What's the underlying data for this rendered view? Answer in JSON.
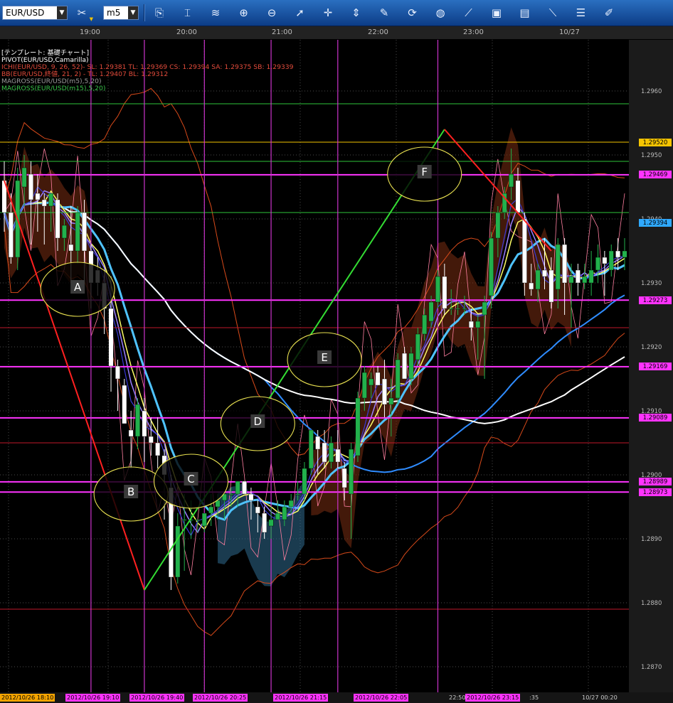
{
  "toolbar": {
    "symbol": "EUR/USD",
    "timeframe": "m5",
    "tools": [
      {
        "name": "clone-chart-icon",
        "glyph": "⎘"
      },
      {
        "name": "candle-style-icon",
        "glyph": "⌶"
      },
      {
        "name": "line-chart-icon",
        "glyph": "≋"
      },
      {
        "name": "zoom-in-icon",
        "glyph": "⊕"
      },
      {
        "name": "zoom-out-icon",
        "glyph": "⊖"
      },
      {
        "name": "cursor-icon",
        "glyph": "➚"
      },
      {
        "name": "crosshair-icon",
        "glyph": "✛"
      },
      {
        "name": "period-separator-icon",
        "glyph": "⇕"
      },
      {
        "name": "edit-chart-icon",
        "glyph": "✎"
      },
      {
        "name": "refresh-icon",
        "glyph": "⟳"
      },
      {
        "name": "globe-icon",
        "glyph": "◍"
      },
      {
        "name": "ruler-icon",
        "glyph": "⟋"
      },
      {
        "name": "image-icon",
        "glyph": "▣"
      },
      {
        "name": "screenshot-icon",
        "glyph": "▤"
      },
      {
        "name": "draw-line-icon",
        "glyph": "⟍"
      },
      {
        "name": "layers-icon",
        "glyph": "☰"
      },
      {
        "name": "pen-icon",
        "glyph": "✐"
      }
    ]
  },
  "time_axis": [
    "19:00",
    "20:00",
    "21:00",
    "22:00",
    "23:00",
    "10/27"
  ],
  "legend": [
    {
      "text": "[テンプレート: 基礎チャート]",
      "color": "#ffffff"
    },
    {
      "text": "PIVOT(EUR/USD,Camarilla)",
      "color": "#ffffff"
    },
    {
      "text": "ICHI(EUR/USD, 9, 26, 52)- SL: 1.29381 TL: 1.29369 CS: 1.29394 SA: 1.29375 SB: 1.29339",
      "color": "#e24b3b"
    },
    {
      "text": "BB(EUR/USD,終値, 21, 2) - TL: 1.29407 BL: 1.29312",
      "color": "#e24b3b"
    },
    {
      "text": "MAGROSS(EUR/USD(m5),5,20)",
      "color": "#9a9a9a"
    },
    {
      "text": "MAGROSS(EUR/USD(m15),5,20)",
      "color": "#39c44a"
    }
  ],
  "price_badges": [
    {
      "text": "1.29520",
      "bg": "#f5c400",
      "fg": "#000000",
      "price": 1.2952
    },
    {
      "text": "1.29469",
      "bg": "#ff33ff",
      "fg": "#000000",
      "price": 1.29469
    },
    {
      "text": "1.29394",
      "bg": "#2fa9ff",
      "fg": "#000000",
      "price": 1.29394
    },
    {
      "text": "1.29273",
      "bg": "#ff33ff",
      "fg": "#000000",
      "price": 1.29273
    },
    {
      "text": "1.29169",
      "bg": "#ff33ff",
      "fg": "#000000",
      "price": 1.29169
    },
    {
      "text": "1.29089",
      "bg": "#ff33ff",
      "fg": "#000000",
      "price": 1.29089
    },
    {
      "text": "1.28989",
      "bg": "#ff33ff",
      "fg": "#000000",
      "price": 1.28989
    },
    {
      "text": "1.28973",
      "bg": "#ff33ff",
      "fg": "#000000",
      "price": 1.28973
    }
  ],
  "date_axis": [
    {
      "text": "2012/10/26 18:10",
      "bg": "#f5a400",
      "fg": "#000000"
    },
    {
      "text": "2012/10/26 19:10",
      "bg": "#ff33ff",
      "fg": "#000000"
    },
    {
      "text": "2012/10/26 19:40",
      "bg": "#ff33ff",
      "fg": "#000000"
    },
    {
      "text": "2012/10/26 20:25",
      "bg": "#ff33ff",
      "fg": "#000000"
    },
    {
      "text": "2012/10/26 21:15",
      "bg": "#ff33ff",
      "fg": "#000000"
    },
    {
      "text": "2012/10/26 22:05",
      "bg": "#ff33ff",
      "fg": "#000000"
    },
    {
      "text": "22:50",
      "bg": "#151515",
      "fg": "#cccccc"
    },
    {
      "text": "2012/10/26 23:15",
      "bg": "#ff33ff",
      "fg": "#000000"
    },
    {
      "text": ":35",
      "bg": "#151515",
      "fg": "#cccccc"
    },
    {
      "text": "10/27 00:20",
      "bg": "#151515",
      "fg": "#cccccc"
    }
  ],
  "chart_data": {
    "type": "candlestick",
    "symbol": "EUR/USD",
    "timeframe": "m5",
    "ylim": [
      1.2866,
      1.2968
    ],
    "y_ticks": [
      1.296,
      1.295,
      1.294,
      1.293,
      1.292,
      1.291,
      1.29,
      1.289,
      1.288,
      1.287
    ],
    "y_tick_labels": [
      "1.2960",
      "1.2950",
      "1.2940",
      "1.2930",
      "1.2920",
      "1.2910",
      "1.2900",
      "1.2890",
      "1.2880",
      "1.2870"
    ],
    "colors": {
      "up": "#22b14c",
      "down": "#ffffff",
      "background": "#000000",
      "grid": "#4a4a4a",
      "pivot": "#ff33ff",
      "marker": "#cc33cc"
    },
    "candles": [
      [
        1.2946,
        1.2949,
        1.2938,
        1.2941
      ],
      [
        1.2941,
        1.2944,
        1.2933,
        1.2934
      ],
      [
        1.2934,
        1.2948,
        1.2932,
        1.2946
      ],
      [
        1.2945,
        1.295,
        1.2942,
        1.2948
      ],
      [
        1.2947,
        1.2949,
        1.2936,
        1.2943
      ],
      [
        1.2944,
        1.2947,
        1.2938,
        1.2943
      ],
      [
        1.2943,
        1.2944,
        1.2936,
        1.2942
      ],
      [
        1.2942,
        1.2944,
        1.2938,
        1.2944
      ],
      [
        1.2943,
        1.2944,
        1.2935,
        1.2937
      ],
      [
        1.2937,
        1.294,
        1.2935,
        1.2939
      ],
      [
        1.2936,
        1.2942,
        1.293,
        1.2935
      ],
      [
        1.2935,
        1.2942,
        1.2933,
        1.2941
      ],
      [
        1.2941,
        1.2943,
        1.293,
        1.2935
      ],
      [
        1.2935,
        1.2936,
        1.2926,
        1.293
      ],
      [
        1.2932,
        1.2934,
        1.2928,
        1.293
      ],
      [
        1.293,
        1.2932,
        1.2922,
        1.2926
      ],
      [
        1.2926,
        1.2931,
        1.2913,
        1.2917
      ],
      [
        1.2917,
        1.2918,
        1.291,
        1.2915
      ],
      [
        1.2914,
        1.2915,
        1.2908,
        1.2908
      ],
      [
        1.2907,
        1.291,
        1.2901,
        1.2906
      ],
      [
        1.2906,
        1.2912,
        1.2904,
        1.2911
      ],
      [
        1.291,
        1.2912,
        1.2902,
        1.2906
      ],
      [
        1.2906,
        1.2909,
        1.2903,
        1.2905
      ],
      [
        1.2905,
        1.2909,
        1.2901,
        1.2903
      ],
      [
        1.2903,
        1.2904,
        1.2893,
        1.29
      ],
      [
        1.2898,
        1.29,
        1.2882,
        1.2884
      ],
      [
        1.2884,
        1.2894,
        1.2883,
        1.2892
      ],
      [
        1.2893,
        1.2897,
        1.2885,
        1.2893
      ],
      [
        1.2893,
        1.2896,
        1.289,
        1.2893
      ],
      [
        1.2893,
        1.2893,
        1.2891,
        1.2893
      ],
      [
        1.2892,
        1.2894,
        1.2891,
        1.2894
      ],
      [
        1.2894,
        1.2897,
        1.2892,
        1.2895
      ],
      [
        1.2895,
        1.2897,
        1.2893,
        1.2896
      ],
      [
        1.2896,
        1.2897,
        1.2893,
        1.2897
      ],
      [
        1.2897,
        1.2898,
        1.2895,
        1.2897
      ],
      [
        1.2897,
        1.2899,
        1.2895,
        1.2899
      ],
      [
        1.2899,
        1.2899,
        1.2897,
        1.2897
      ],
      [
        1.2897,
        1.2898,
        1.2893,
        1.2896
      ],
      [
        1.2895,
        1.2896,
        1.2891,
        1.2894
      ],
      [
        1.2894,
        1.2895,
        1.289,
        1.2891
      ],
      [
        1.2892,
        1.2895,
        1.289,
        1.2893
      ],
      [
        1.2893,
        1.2896,
        1.2893,
        1.2894
      ],
      [
        1.2893,
        1.2896,
        1.2892,
        1.2895
      ],
      [
        1.2895,
        1.2897,
        1.2894,
        1.2896
      ],
      [
        1.2897,
        1.2899,
        1.2896,
        1.2897
      ],
      [
        1.2897,
        1.2902,
        1.2896,
        1.2901
      ],
      [
        1.2901,
        1.2907,
        1.29,
        1.2907
      ],
      [
        1.2906,
        1.2907,
        1.29,
        1.2904
      ],
      [
        1.2905,
        1.2907,
        1.2901,
        1.2902
      ],
      [
        1.2902,
        1.2906,
        1.2901,
        1.2905
      ],
      [
        1.2904,
        1.2907,
        1.2901,
        1.2902
      ],
      [
        1.2901,
        1.2902,
        1.2896,
        1.2898
      ],
      [
        1.2897,
        1.2905,
        1.289,
        1.2904
      ],
      [
        1.2903,
        1.2913,
        1.2902,
        1.2912
      ],
      [
        1.2912,
        1.2917,
        1.291,
        1.2916
      ],
      [
        1.2914,
        1.2916,
        1.2912,
        1.2915
      ],
      [
        1.2916,
        1.2917,
        1.2914,
        1.2914
      ],
      [
        1.2915,
        1.2918,
        1.2909,
        1.2911
      ],
      [
        1.2911,
        1.2915,
        1.2906,
        1.2912
      ],
      [
        1.2912,
        1.2919,
        1.2911,
        1.2918
      ],
      [
        1.2919,
        1.292,
        1.2915,
        1.2915
      ],
      [
        1.2915,
        1.292,
        1.2914,
        1.2919
      ],
      [
        1.2918,
        1.2923,
        1.2917,
        1.2922
      ],
      [
        1.2922,
        1.2926,
        1.2921,
        1.2925
      ],
      [
        1.2924,
        1.2928,
        1.2923,
        1.2927
      ],
      [
        1.2927,
        1.2932,
        1.2926,
        1.2931
      ],
      [
        1.2931,
        1.2933,
        1.2925,
        1.2926
      ],
      [
        1.2926,
        1.2929,
        1.2925,
        1.2926
      ],
      [
        1.2926,
        1.2927,
        1.2925,
        1.2926
      ],
      [
        1.2926,
        1.2928,
        1.2925,
        1.2926
      ],
      [
        1.2924,
        1.2926,
        1.2921,
        1.2923
      ],
      [
        1.2923,
        1.2925,
        1.2918,
        1.2924
      ],
      [
        1.2925,
        1.2928,
        1.2915,
        1.2927
      ],
      [
        1.2928,
        1.2938,
        1.2926,
        1.2937
      ],
      [
        1.2937,
        1.2942,
        1.2934,
        1.2941
      ],
      [
        1.2941,
        1.2945,
        1.294,
        1.2944
      ],
      [
        1.2945,
        1.2951,
        1.2943,
        1.2947
      ],
      [
        1.2946,
        1.2948,
        1.2941,
        1.2941
      ],
      [
        1.294,
        1.2941,
        1.2928,
        1.293
      ],
      [
        1.293,
        1.2933,
        1.2928,
        1.2929
      ],
      [
        1.2929,
        1.2933,
        1.2927,
        1.2932
      ],
      [
        1.2932,
        1.2937,
        1.2929,
        1.2931
      ],
      [
        1.2932,
        1.2934,
        1.2926,
        1.2927
      ],
      [
        1.2929,
        1.2937,
        1.2926,
        1.2936
      ],
      [
        1.2936,
        1.2937,
        1.2925,
        1.293
      ],
      [
        1.293,
        1.2933,
        1.2923,
        1.2931
      ],
      [
        1.2932,
        1.2933,
        1.2928,
        1.293
      ],
      [
        1.293,
        1.2933,
        1.2929,
        1.2931
      ],
      [
        1.293,
        1.2935,
        1.2928,
        1.2932
      ],
      [
        1.2932,
        1.2936,
        1.293,
        1.2934
      ],
      [
        1.2934,
        1.2935,
        1.2928,
        1.2933
      ],
      [
        1.2932,
        1.2936,
        1.2931,
        1.2935
      ],
      [
        1.2935,
        1.2937,
        1.2932,
        1.2934
      ],
      [
        1.2934,
        1.2937,
        1.2932,
        1.2935
      ]
    ],
    "pivot_levels": [
      1.2952,
      1.29469,
      1.29273,
      1.29169,
      1.29089,
      1.28989,
      1.28973
    ],
    "time_markers": [
      {
        "label": "2012/10/26 19:10",
        "index": 13
      },
      {
        "label": "2012/10/26 19:40",
        "index": 21
      },
      {
        "label": "2012/10/26 20:25",
        "index": 30
      },
      {
        "label": "2012/10/26 21:15",
        "index": 40
      },
      {
        "label": "2012/10/26 22:05",
        "index": 50
      },
      {
        "label": "2012/10/26 23:15",
        "index": 65
      }
    ],
    "annotations": [
      {
        "label": "A",
        "index": 11,
        "price": 1.2929
      },
      {
        "label": "B",
        "index": 19,
        "price": 1.2897
      },
      {
        "label": "C",
        "index": 28,
        "price": 1.2899
      },
      {
        "label": "D",
        "index": 38,
        "price": 1.2908
      },
      {
        "label": "E",
        "index": 48,
        "price": 1.2918
      },
      {
        "label": "F",
        "index": 63,
        "price": 1.2947
      }
    ],
    "trend_lines": [
      {
        "color": "#ff2020",
        "from": {
          "index": 0,
          "price": 1.2946
        },
        "to": {
          "index": 21,
          "price": 1.2882
        }
      },
      {
        "color": "#33dd33",
        "from": {
          "index": 21,
          "price": 1.2882
        },
        "to": {
          "index": 66,
          "price": 1.2954
        }
      },
      {
        "color": "#ff2020",
        "from": {
          "index": 66,
          "price": 1.2954
        },
        "to": {
          "index": 82,
          "price": 1.2935
        }
      }
    ]
  }
}
